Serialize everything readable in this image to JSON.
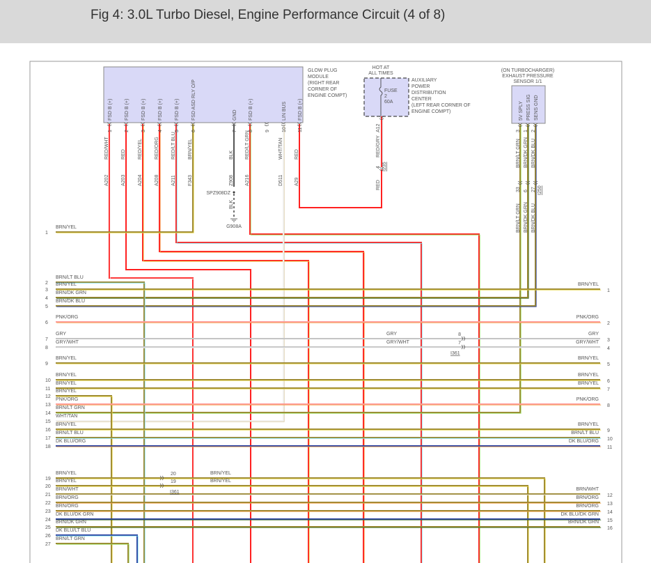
{
  "header": {
    "title": "Fig 4: 3.0L Turbo Diesel, Engine Performance Circuit (4 of 8)"
  },
  "wire_palette": {
    "RED": "#ff2020",
    "BRN": "#9a8630",
    "YEL": "#e8d84a",
    "ORG": "#f2a24a",
    "LT BLU": "#7fe3f2",
    "LT GRN": "#98dd5a",
    "DK GRN": "#3c6e22",
    "DK BLU": "#2a40a0",
    "WHT": "#f2f2f2",
    "GRY": "#c4c4c4",
    "PNK": "#ff9a9a",
    "TAN": "#d8c8a0",
    "BLK": "#555555"
  },
  "glow_plug_module": {
    "label_lines": [
      "GLOW PLUG",
      "MODULE",
      "(RIGHT REAR",
      "CORNER OF",
      "ENGINE COMPT)"
    ],
    "fill": "#d9d9f7",
    "pins": [
      {
        "num": "1",
        "name": "FSD B (+)",
        "wire": "RED/WHT",
        "circuit": "A202"
      },
      {
        "num": "2",
        "name": "FSD B (+)",
        "wire": "RED",
        "circuit": "A203"
      },
      {
        "num": "3",
        "name": "FSD B (+)",
        "wire": "RED/YEL",
        "circuit": "A204"
      },
      {
        "num": "4",
        "name": "FSD B (+)",
        "wire": "RED/ORG",
        "circuit": "A208"
      },
      {
        "num": "5",
        "name": "FSD B (+)",
        "wire": "RED/LT BLU",
        "circuit": "A211"
      },
      {
        "num": "6",
        "name": "FSD ASD RLY O/P",
        "wire": "BRN/YEL",
        "circuit": "F343"
      },
      {
        "num": "7",
        "name": "GND",
        "wire": "BLK",
        "circuit": "Z908"
      },
      {
        "num": "8",
        "name": "FSD B (+)",
        "wire": "RED/LT GRN",
        "circuit": "A216"
      },
      {
        "num": "9",
        "name": "",
        "wire": "",
        "circuit": ""
      },
      {
        "num": "10",
        "name": "LIN BUS",
        "wire": "WHT/TAN",
        "circuit": "D511"
      },
      {
        "num": "11",
        "name": "FSD B (+)",
        "wire": "RED",
        "circuit": "A29"
      }
    ]
  },
  "ground": {
    "splice": "SPZ908DZ",
    "wire": "BLK",
    "ground": "G908A"
  },
  "power_distribution": {
    "hot_label": [
      "HOT AT",
      "ALL TIMES"
    ],
    "label_lines": [
      "AUXILIARY",
      "POWER",
      "DISTRIBUTION",
      "CENTER",
      "(LEFT REAR CORNER OF",
      "ENGINE COMPT)"
    ],
    "fuse": [
      "FUSE",
      "2",
      "60A"
    ],
    "circuit": "A12",
    "wire": "RED/GRY",
    "connector": {
      "id": "I235",
      "pin": "4"
    },
    "wire_after": "RED"
  },
  "sensor": {
    "label_lines": [
      "(ON TURBOCHARGER)",
      "EXHAUST PRESSURE",
      "SENSOR 1/1"
    ],
    "pins": [
      {
        "num": "3",
        "name": "5V SPLY",
        "wire": "BRN/LT GRN",
        "conn_pin": "33"
      },
      {
        "num": "1",
        "name": "PRESS SIG",
        "wire": "BRN/DK GRN",
        "conn_pin": "6"
      },
      {
        "num": "2",
        "name": "SENS GND",
        "wire": "BRN/DK BLU",
        "conn_pin": "27"
      }
    ],
    "connector": "I250"
  },
  "left_rows": [
    {
      "num": "1",
      "wire": "BRN/YEL"
    },
    {
      "num": "2",
      "wire": "BRN/LT BLU"
    },
    {
      "num": "3",
      "wire": "BRN/YEL"
    },
    {
      "num": "4",
      "wire": "BRN/DK GRN"
    },
    {
      "num": "5",
      "wire": "BRN/DK BLU"
    },
    {
      "num": "6",
      "wire": "PNK/ORG"
    },
    {
      "num": "7",
      "wire": "GRY"
    },
    {
      "num": "8",
      "wire": "GRY/WHT"
    },
    {
      "num": "9",
      "wire": "BRN/YEL"
    },
    {
      "num": "10",
      "wire": "BRN/YEL"
    },
    {
      "num": "11",
      "wire": "BRN/YEL"
    },
    {
      "num": "12",
      "wire": "BRN/YEL"
    },
    {
      "num": "13",
      "wire": "PNK/ORG"
    },
    {
      "num": "14",
      "wire": "BRN/LT GRN"
    },
    {
      "num": "15",
      "wire": "WHT/TAN"
    },
    {
      "num": "16",
      "wire": "BRN/YEL"
    },
    {
      "num": "17",
      "wire": "BRN/LT BLU"
    },
    {
      "num": "18",
      "wire": "DK BLU/ORG"
    },
    {
      "num": "19",
      "wire": "BRN/YEL"
    },
    {
      "num": "20",
      "wire": "BRN/YEL"
    },
    {
      "num": "21",
      "wire": "BRN/WHT"
    },
    {
      "num": "22",
      "wire": "BRN/ORG"
    },
    {
      "num": "23",
      "wire": "BRN/ORG"
    },
    {
      "num": "24",
      "wire": "DK BLU/DK GRN"
    },
    {
      "num": "25",
      "wire": "BRN/DK GRN"
    },
    {
      "num": "26",
      "wire": "DK BLU/LT BLU"
    },
    {
      "num": "27",
      "wire": "BRN/LT GRN"
    }
  ],
  "right_rows": [
    {
      "num": "1",
      "wire": "BRN/YEL"
    },
    {
      "num": "2",
      "wire": "PNK/ORG"
    },
    {
      "num": "3",
      "wire": "GRY"
    },
    {
      "num": "4",
      "wire": "GRY/WHT"
    },
    {
      "num": "5",
      "wire": "BRN/YEL"
    },
    {
      "num": "6",
      "wire": "BRN/YEL"
    },
    {
      "num": "7",
      "wire": "BRN/YEL"
    },
    {
      "num": "8",
      "wire": "PNK/ORG"
    },
    {
      "num": "9",
      "wire": "BRN/YEL"
    },
    {
      "num": "10",
      "wire": "BRN/LT BLU"
    },
    {
      "num": "11",
      "wire": "DK BLU/ORG"
    },
    {
      "num": "12",
      "wire": "BRN/WHT"
    },
    {
      "num": "13",
      "wire": "BRN/ORG"
    },
    {
      "num": "14",
      "wire": "BRN/ORG"
    },
    {
      "num": "15",
      "wire": "DK BLU/DK GRN"
    },
    {
      "num": "16",
      "wire": "BRN/DK GRN"
    }
  ],
  "inline_connectors": [
    {
      "id": "I361",
      "pins": [
        "8",
        "7"
      ],
      "wires": [
        "GRY",
        "GRY/WHT"
      ]
    },
    {
      "id": "I361",
      "pins": [
        "20",
        "19"
      ],
      "wires": [
        "BRN/YEL",
        "BRN/YEL"
      ]
    }
  ]
}
